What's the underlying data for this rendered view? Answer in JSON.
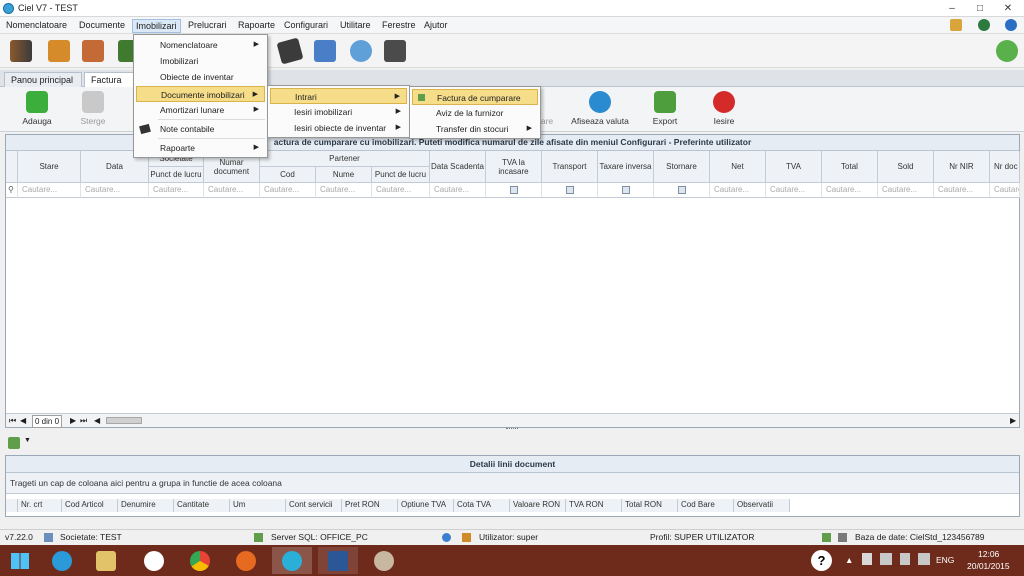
{
  "window": {
    "title": "Ciel V7 - TEST"
  },
  "menubar": {
    "items": [
      "Nomenclatoare",
      "Documente",
      "Imobilizari",
      "Prelucrari",
      "Rapoarte",
      "Configurari",
      "Utilitare",
      "Ferestre",
      "Ajutor"
    ],
    "active": "Imobilizari"
  },
  "tabs": [
    {
      "label": "Panou principal"
    },
    {
      "label": "Factura de"
    }
  ],
  "ribbon": {
    "adauga": "Adauga",
    "sterge": "Sterge",
    "are": "are",
    "afiseaza_valuta": "Afiseaza valuta",
    "export": "Export",
    "iesire": "Iesire"
  },
  "grid": {
    "title": "actura de cumparare cu imobilizari. Puteti modifica numarul de zile afisate din meniul Configurari - Preferinte utilizator",
    "columns": {
      "stare": "Stare",
      "data": "Data",
      "societate": "Societate",
      "punct_lucru": "Punct de lucru",
      "numar_document": "Numar document",
      "partener": "Partener",
      "cod": "Cod",
      "nume": "Nume",
      "partener_punct": "Punct de lucru",
      "data_scadenta": "Data Scadenta",
      "tva_incasare": "TVA la incasare",
      "transport": "Transport",
      "taxare_inversa": "Taxare inversa",
      "stornare": "Stornare",
      "net": "Net",
      "tva": "TVA",
      "total": "Total",
      "sold": "Sold",
      "nr_nir": "Nr NIR",
      "nr_doc": "Nr doc"
    },
    "filter_placeholder": "Cautare...",
    "nav_counter": "0 din 0"
  },
  "details": {
    "title": "Detalii linii document",
    "group_hint": "Trageti un cap de coloana aici pentru a grupa in functie de acea coloana",
    "columns": [
      "Nr. crt",
      "Cod Articol",
      "Denumire",
      "Cantitate",
      "Um",
      "Cont servicii",
      "Pret RON",
      "Optiune TVA",
      "Cota TVA",
      "Valoare RON",
      "TVA RON",
      "Total RON",
      "Cod Bare",
      "Observatii"
    ]
  },
  "statusbar": {
    "version": "v7.22.0",
    "company": "Societate: TEST",
    "server": "Server SQL: OFFICE_PC",
    "user": "Utilizator: super",
    "profile": "Profil: SUPER UTILIZATOR",
    "database": "Baza de date: CielStd_123456789"
  },
  "menus": {
    "imobilizari": [
      "Nomenclatoare",
      "Imobilizari",
      "Obiecte de inventar",
      "Documente imobilizari",
      "Amortizari lunare",
      "Note contabile",
      "Rapoarte"
    ],
    "documente_imobilizari": [
      "Intrari",
      "Iesiri imobilizari",
      "Iesiri obiecte de inventar"
    ],
    "intrari": [
      "Factura de cumparare",
      "Aviz de la furnizor",
      "Transfer din stocuri"
    ]
  },
  "taskbar": {
    "lang": "ENG",
    "time": "12:06",
    "date": "20/01/2015",
    "help": "?"
  },
  "colors": {
    "taskbar": "#6e2b1c",
    "menu_highlight": "#f6dd8a",
    "header_bg": "#e6ecf3"
  }
}
